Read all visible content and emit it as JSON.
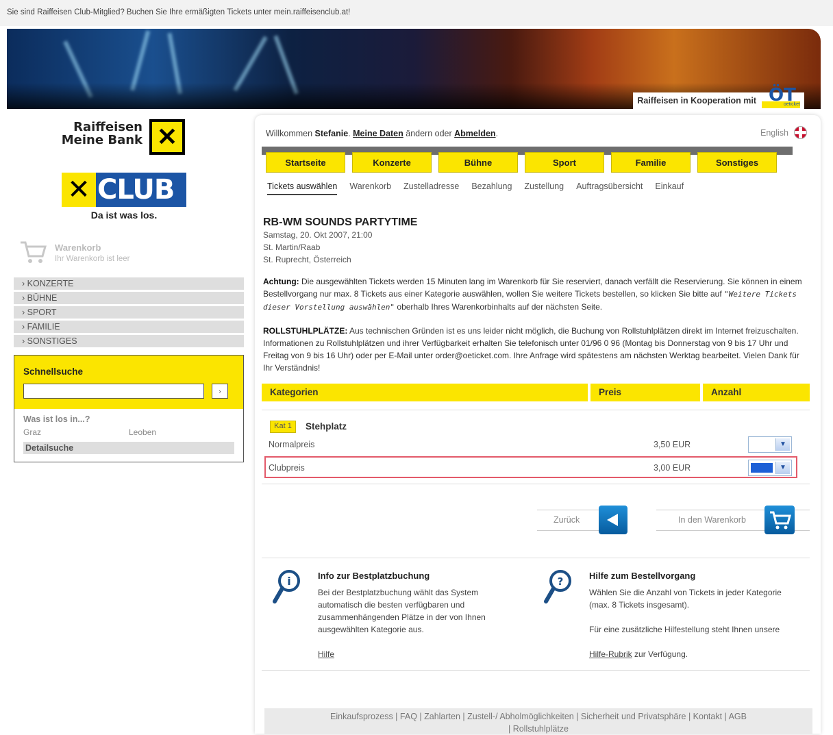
{
  "topbar": {
    "text": "Sie sind Raiffeisen Club-Mitglied? Buchen Sie Ihre ermäßigten Tickets unter mein.raiffeisenclub.at!"
  },
  "banner": {
    "cooperation": "Raiffeisen in Kooperation mit",
    "partner_logo": "ÖT",
    "partner_sub": "oeticket"
  },
  "logo": {
    "line1": "Raiffeisen",
    "line2": "Meine Bank",
    "club": "CLUB",
    "tagline": "Da ist was los."
  },
  "sidecart": {
    "title": "Warenkorb",
    "status": "Ihr Warenkorb ist leer"
  },
  "sidenav": [
    {
      "label": "› KONZERTE"
    },
    {
      "label": "› BÜHNE"
    },
    {
      "label": "› SPORT"
    },
    {
      "label": "› FAMILIE"
    },
    {
      "label": "› SONSTIGES"
    }
  ],
  "quicksearch": {
    "title": "Schnellsuche",
    "value": "",
    "button": "›",
    "heading": "Was ist los in...?",
    "city1": "Graz",
    "city2": "Leoben",
    "detail": "Detailsuche"
  },
  "header": {
    "welcome_prefix": "Willkommen ",
    "user": "Stefanie",
    "sep1": ". ",
    "my_data": "Meine Daten",
    "mid": " ändern oder ",
    "logout": "Abmelden",
    "end": ".",
    "language": "English"
  },
  "tabs": [
    "Startseite",
    "Konzerte",
    "Bühne",
    "Sport",
    "Familie",
    "Sonstiges"
  ],
  "steps": [
    "Tickets auswählen",
    "Warenkorb",
    "Zustelladresse",
    "Bezahlung",
    "Zustellung",
    "Auftragsübersicht",
    "Einkauf"
  ],
  "event": {
    "title": "RB-WM SOUNDS PARTYTIME",
    "date": "Samstag, 20. Okt 2007, 21:00",
    "venue": "St. Martin/Raab",
    "location": "St. Ruprecht, Österreich"
  },
  "notice": {
    "label": "Achtung:",
    "text1": " Die ausgewählten Tickets werden 15 Minuten lang im Warenkorb für Sie reserviert, danach verfällt die Reservierung. Sie können in einem Bestellvorgang nur max. 8 Tickets aus einer Kategorie auswählen, wollen Sie weitere Tickets bestellen, so klicken Sie bitte auf ",
    "link": "\"Weitere Tickets dieser Vorstellung auswählen\"",
    "text2": " oberhalb Ihres Warenkorbinhalts auf der nächsten Seite."
  },
  "wheelchair": {
    "label": "ROLLSTUHLPLÄTZE:",
    "text": " Aus technischen Gründen ist es uns leider nicht möglich, die Buchung von Rollstuhlplätzen direkt im Internet freizuschalten. Informationen zu Rollstuhlplätzen und ihrer Verfügbarkeit erhalten Sie telefonisch unter 01/96 0 96 (Montag bis Donnerstag von 9 bis 17 Uhr und Freitag von 9 bis 16 Uhr) oder per E-Mail unter order@oeticket.com. Ihre Anfrage wird spätestens am nächsten Werktag bearbeitet. Vielen Dank für Ihr Verständnis!"
  },
  "table": {
    "headers": [
      "Kategorien",
      "Preis",
      "Anzahl"
    ],
    "category_badge": "Kat 1",
    "category_name": "Stehplatz",
    "rows": [
      {
        "label": "Normalpreis",
        "price": "3,50 EUR",
        "qty": ""
      },
      {
        "label": "Clubpreis",
        "price": "3,00 EUR",
        "qty": ""
      }
    ]
  },
  "actions": {
    "back": "Zurück",
    "add_to_cart": "In den Warenkorb"
  },
  "info": {
    "left_title": "Info zur Bestplatzbuchung",
    "left_text": "Bei der Bestplatzbuchung wählt das System automatisch die besten verfügbaren und zusammenhängenden Plätze in der von Ihnen ausgewählten Kategorie aus.",
    "left_link": "Hilfe",
    "right_title": "Hilfe zum Bestellvorgang",
    "right_text1": "Wählen Sie die Anzahl von Tickets in jeder Kategorie (max. 8 Tickets insgesamt).",
    "right_text2": "Für eine zusätzliche Hilfestellung steht Ihnen unsere",
    "right_link": "Hilfe-Rubrik",
    "right_text3": " zur Verfügung."
  },
  "footer": {
    "line1": "Einkaufsprozess  |  FAQ  |  Zahlarten  |  Zustell-/ Abholmöglichkeiten  |  Sicherheit und Privatsphäre  |  Kontakt  |  AGB",
    "line2": "|  Rollstuhlplätze"
  },
  "colors": {
    "brand_yellow": "#fbe500",
    "brand_blue": "#1c55a5",
    "highlight": "#e35a6a"
  }
}
